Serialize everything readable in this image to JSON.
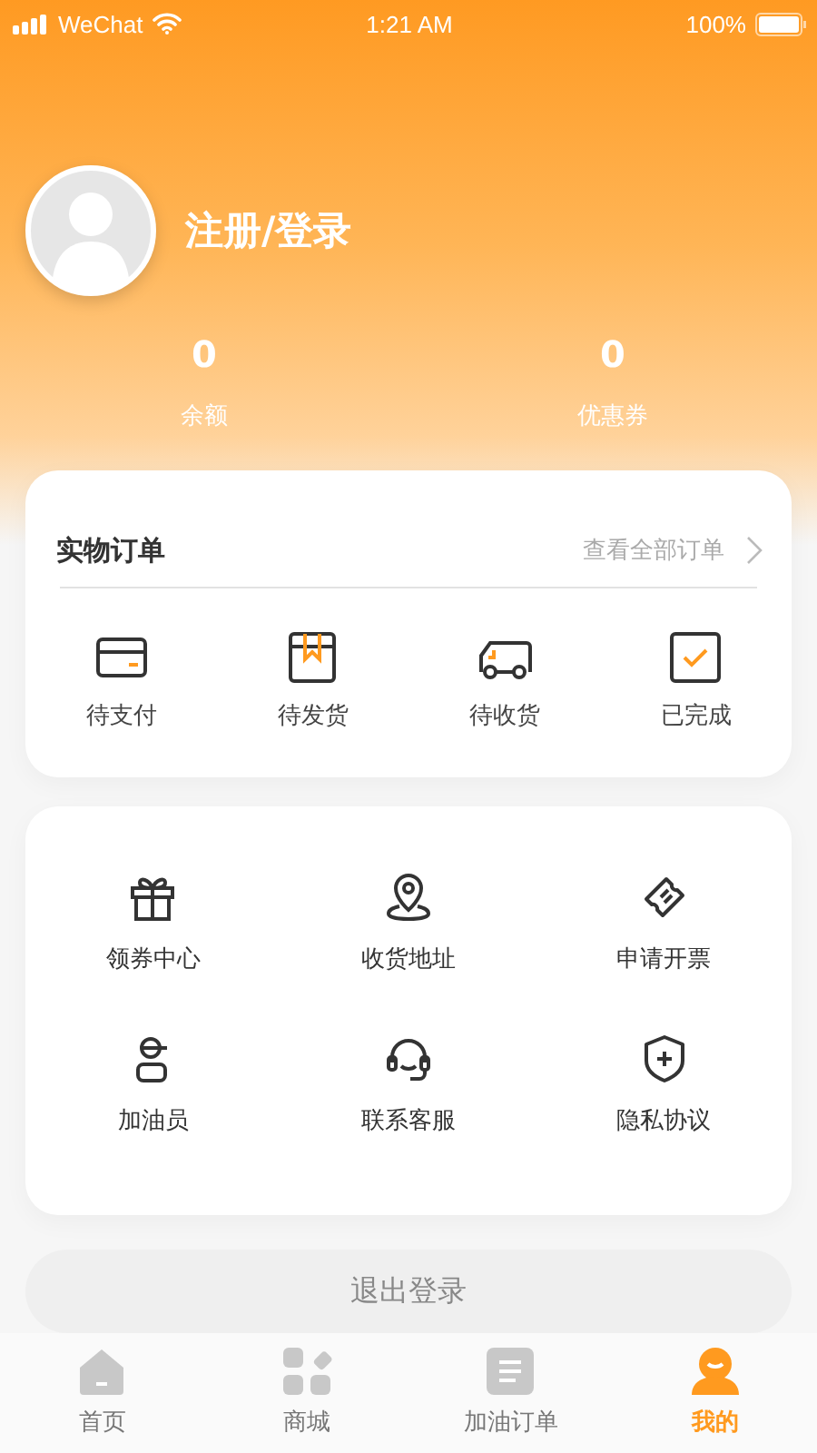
{
  "status_bar": {
    "carrier": "WeChat",
    "time": "1:21 AM",
    "battery": "100%"
  },
  "profile": {
    "login_label": "注册/登录"
  },
  "stats": [
    {
      "value": "0",
      "label": "余额"
    },
    {
      "value": "0",
      "label": "优惠券"
    }
  ],
  "orders": {
    "title": "实物订单",
    "view_all": "查看全部订单",
    "items": [
      {
        "kind": "card",
        "label": "待支付"
      },
      {
        "kind": "box",
        "label": "待发货"
      },
      {
        "kind": "truck",
        "label": "待收货"
      },
      {
        "kind": "check",
        "label": "已完成"
      }
    ]
  },
  "services": [
    {
      "kind": "gift",
      "label": "领券中心"
    },
    {
      "kind": "pin",
      "label": "收货地址"
    },
    {
      "kind": "ticket",
      "label": "申请开票"
    },
    {
      "kind": "worker",
      "label": "加油员"
    },
    {
      "kind": "headset",
      "label": "联系客服"
    },
    {
      "kind": "shield",
      "label": "隐私协议"
    }
  ],
  "logout": "退出登录",
  "tabs": [
    {
      "kind": "home",
      "label": "首页",
      "selected": false
    },
    {
      "kind": "shop",
      "label": "商城",
      "selected": false
    },
    {
      "kind": "orders",
      "label": "加油订单",
      "selected": false
    },
    {
      "kind": "profile",
      "label": "我的",
      "selected": true
    }
  ]
}
